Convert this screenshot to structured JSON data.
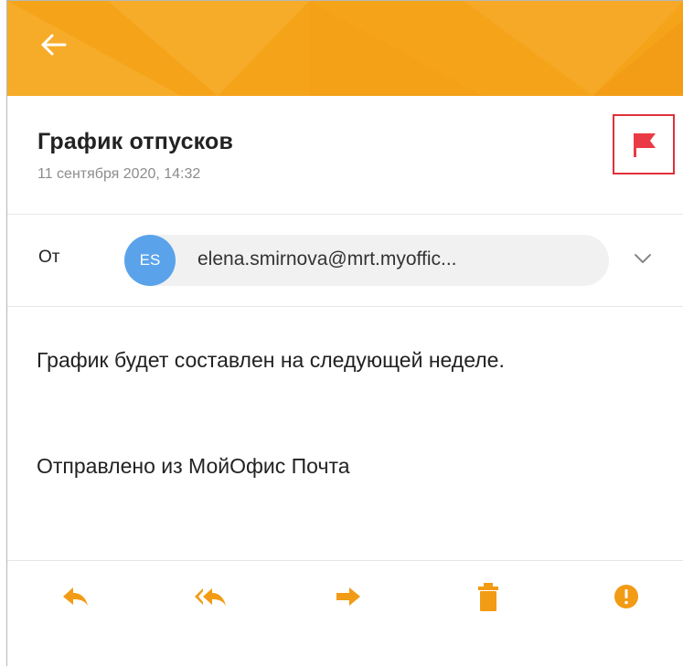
{
  "header": {
    "back_icon": "arrow-left-icon",
    "colors": {
      "bar": "#f5a41a",
      "accent": "#f29b14"
    }
  },
  "message": {
    "subject": "График отпусков",
    "date": "11 сентября 2020, 14:32",
    "flag_icon": "flag-icon",
    "flag_color": "#ea3a45"
  },
  "from": {
    "label": "От",
    "avatar_initials": "ES",
    "avatar_color": "#5aa3eb",
    "email": "elena.smirnova@mrt.myoffic...",
    "expand_icon": "chevron-down-icon"
  },
  "body": {
    "text": "График будет составлен на следующей неделе.",
    "signature": "Отправлено из МойОфис Почта"
  },
  "actions": [
    {
      "icon": "reply-icon"
    },
    {
      "icon": "reply-all-icon"
    },
    {
      "icon": "forward-icon"
    },
    {
      "icon": "trash-icon"
    },
    {
      "icon": "spam-icon"
    }
  ]
}
